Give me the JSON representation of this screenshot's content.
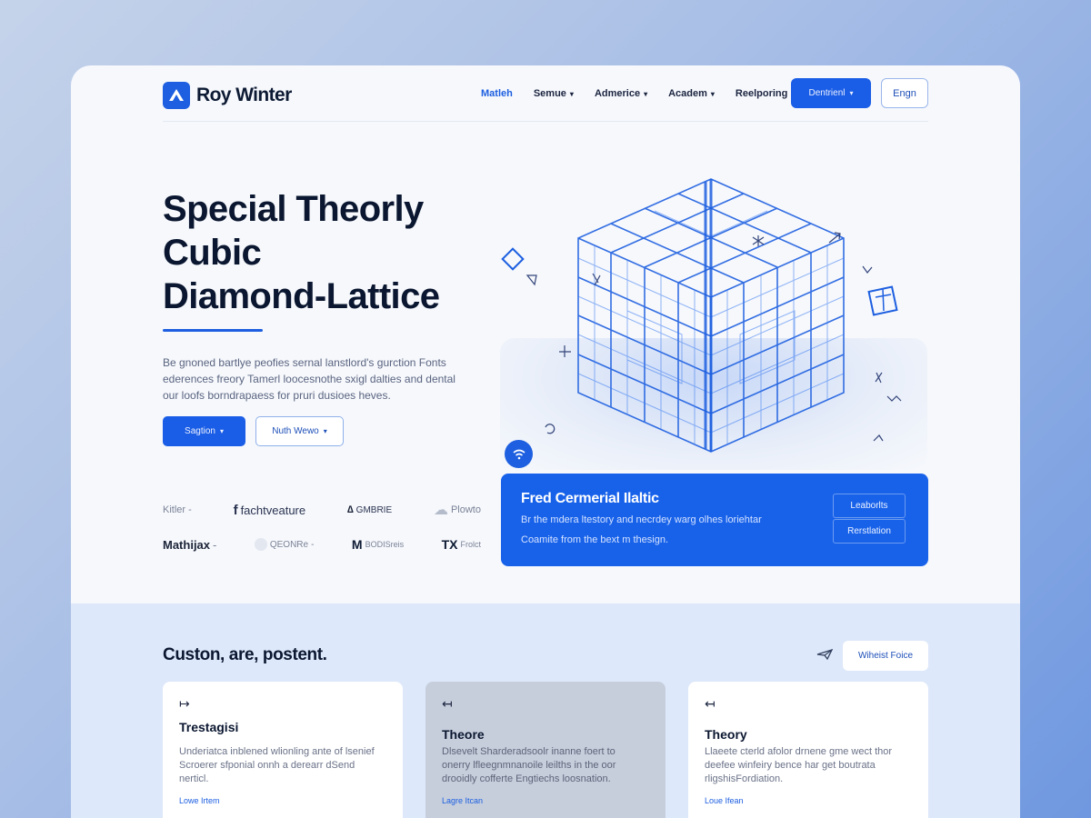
{
  "brand": {
    "name": "Roy Winter",
    "accent": "#1d5fe0",
    "logo_icon": "mountain-logo-icon"
  },
  "nav": {
    "items": [
      {
        "label": "Matleh",
        "dropdown": false,
        "active": true
      },
      {
        "label": "Semue",
        "dropdown": true,
        "active": false
      },
      {
        "label": "Admerice",
        "dropdown": true,
        "active": false
      },
      {
        "label": "Academ",
        "dropdown": true,
        "active": false
      },
      {
        "label": "Reelporing",
        "dropdown": false,
        "active": false
      }
    ],
    "primary_cta": "Dentrienl",
    "secondary_cta": "Engn"
  },
  "hero": {
    "title_lines": [
      "Special Theorly",
      "Cubic",
      "Diamond-Lattice"
    ],
    "description": "Be gnoned bartlye peofies sernal lanstlord's gurction Fonts ederences freory Tamerl loocesnothe sxigl dalties and dental our loofs borndrapaess for pruri dusioes heves.",
    "primary_button": "Sagtion",
    "secondary_button": "Nuth Wewo"
  },
  "partners": [
    [
      {
        "label": "Kitler",
        "suffix": "-",
        "style": "muted"
      },
      {
        "label": "fachtveature",
        "prefix": "f",
        "style": "muted"
      },
      {
        "label": "GMBRIE",
        "prefix": "∆",
        "style": "muted"
      },
      {
        "label": "Plowto",
        "prefix": "☁",
        "style": "muted"
      }
    ],
    [
      {
        "label": "Mathijax",
        "suffix": "-",
        "style": "dark"
      },
      {
        "label": "QEONRe",
        "suffix": "-",
        "style": "muted"
      },
      {
        "label": "BODISreis",
        "prefix": "M",
        "style": "muted"
      },
      {
        "label": "Frolct",
        "prefix": "TX",
        "style": "muted"
      }
    ]
  ],
  "info_card": {
    "title": "Fred Cermerial Ilaltic",
    "line1": "Br the mdera ltestory and necrdey warg olhes loriehtar",
    "line2": "Coamite from the bext m thesign.",
    "button1": "Leaborlts",
    "button2": "Rerstlation",
    "background": "#1862ea"
  },
  "section": {
    "title": "Custon, are, postent.",
    "chip": "Wiheist Foice"
  },
  "cards": [
    {
      "arrow": "↦",
      "title": "Trestagisi",
      "body": "Underiatca inblened wlionling ante of lsenief Scroerer sfponial onnh a derearr dSend nerticl.",
      "link": "Lowe Irtem"
    },
    {
      "arrow": "↤",
      "title": "Theore",
      "body": "Dlsevelt Sharderadsoolr inanne foert to onerry lfleegnmnanoile leilths in the oor drooidly cofferte Engtiechs loosnation.",
      "link": "Lagre Itcan"
    },
    {
      "arrow": "↤",
      "title": "Theory",
      "body": "Llaeete cterld afolor drnene gme wect thor deefee winfeiry bence har get boutrata rligshisFordiation.",
      "link": "Loue Ifean"
    }
  ]
}
